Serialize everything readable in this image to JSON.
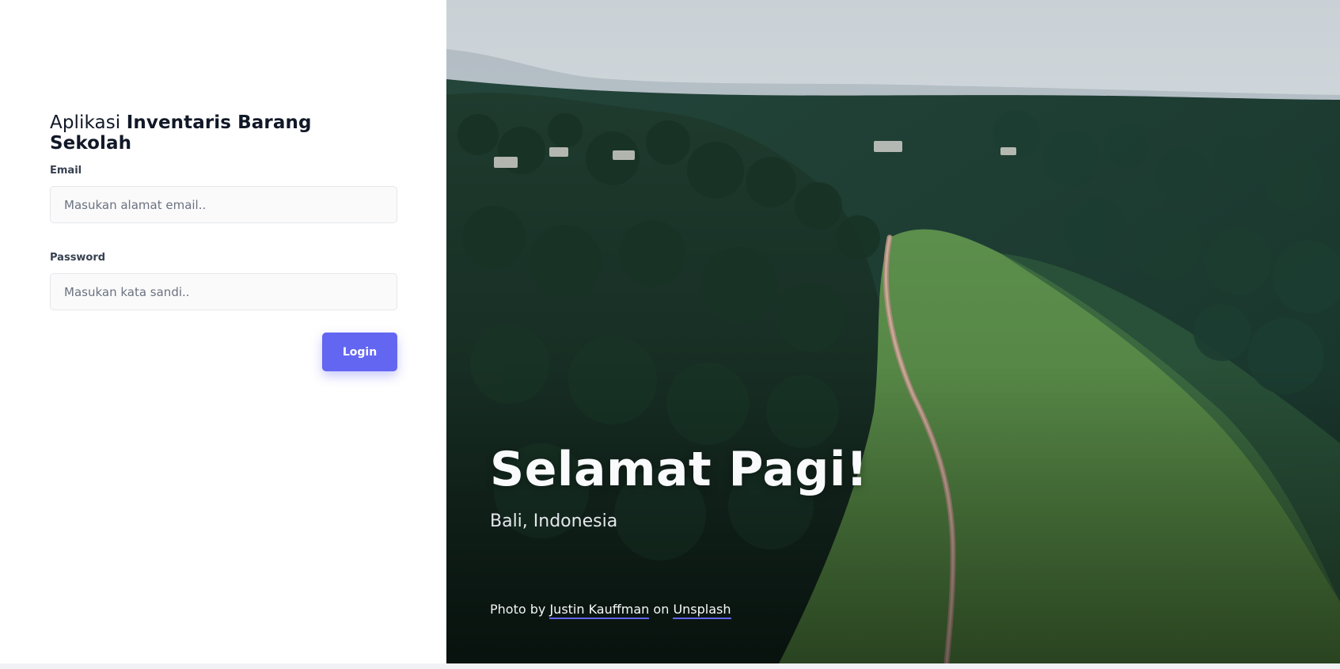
{
  "app": {
    "title_prefix": "Aplikasi",
    "title_bold": "Inventaris Barang Sekolah"
  },
  "form": {
    "email_label": "Email",
    "email_placeholder": "Masukan alamat email..",
    "email_value": "",
    "password_label": "Password",
    "password_placeholder": "Masukan kata sandi..",
    "password_value": "",
    "login_label": "Login"
  },
  "hero": {
    "greeting": "Selamat Pagi!",
    "location": "Bali, Indonesia",
    "credit_prefix": "Photo by",
    "credit_author": "Justin Kauffman",
    "credit_mid": "on",
    "credit_site": "Unsplash"
  },
  "colors": {
    "accent": "#6366f1",
    "left_bg": "#ffffff",
    "input_bg": "#fafafa"
  }
}
